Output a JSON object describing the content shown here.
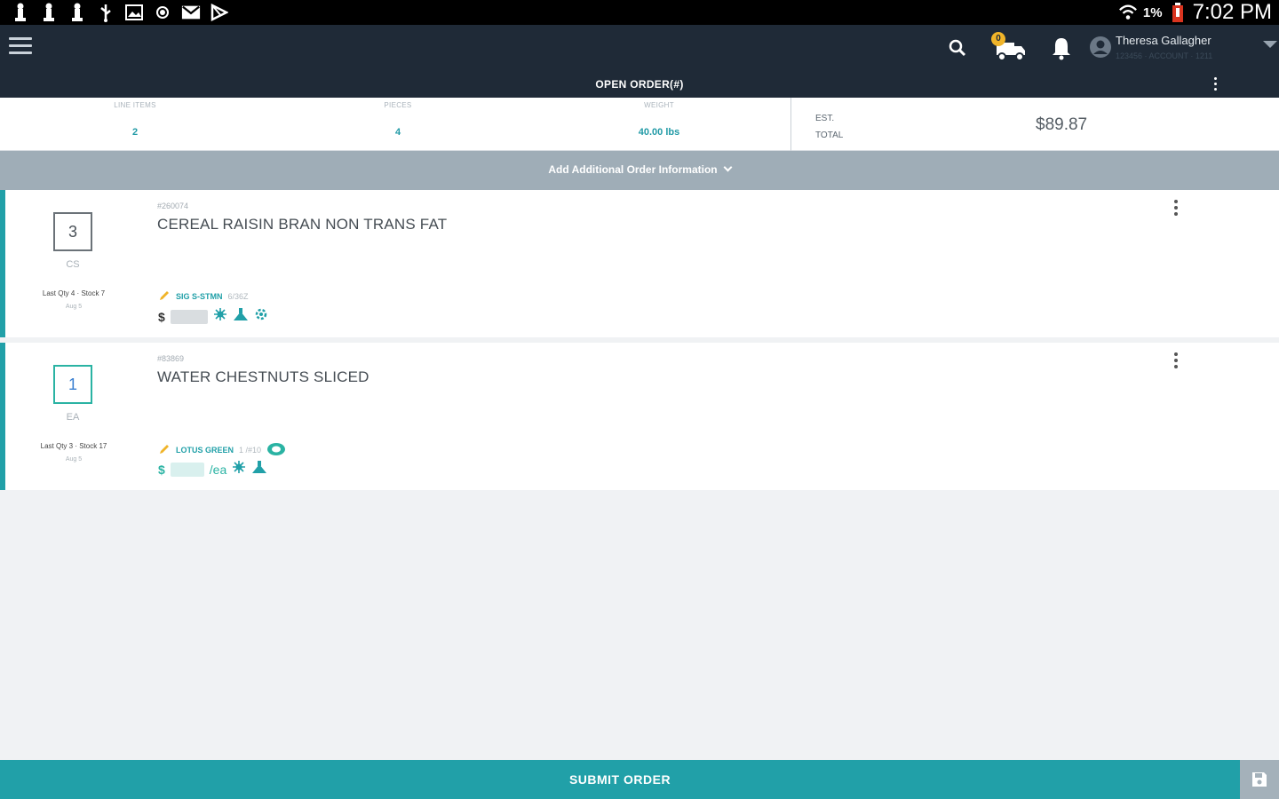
{
  "status_bar": {
    "battery_percent": "1%",
    "time": "7:02 PM"
  },
  "header": {
    "truck_badge": "0",
    "user_name": "Theresa Gallagher",
    "user_sub": "123456 · ACCOUNT · 1211"
  },
  "title_bar": {
    "title": "OPEN ORDER(#)"
  },
  "summary": {
    "line_items_label": "LINE ITEMS",
    "line_items_value": "2",
    "pieces_label": "PIECES",
    "pieces_value": "4",
    "weight_label": "WEIGHT",
    "weight_value": "40.00 lbs",
    "est_label_1": "EST.",
    "est_label_2": "TOTAL",
    "est_total": "$89.87"
  },
  "add_info": {
    "label": "Add Additional Order Information"
  },
  "items": [
    {
      "qty": "3",
      "uom": "CS",
      "last_qty": "Last Qty 4 · Stock 7",
      "last_date": "Aug 5",
      "item_number": "#260074",
      "name": "CEREAL RAISIN BRAN NON TRANS FAT",
      "brand": "SIG S-STMN",
      "pack": "6/36Z",
      "currency": "$",
      "per_unit": ""
    },
    {
      "qty": "1",
      "uom": "EA",
      "last_qty": "Last Qty 3 · Stock 17",
      "last_date": "Aug 5",
      "item_number": "#83869",
      "name": "WATER CHESTNUTS SLICED",
      "brand": "LOTUS GREEN",
      "pack": "1 /#10",
      "currency": "$",
      "per_unit": "/ea"
    }
  ],
  "footer": {
    "submit_label": "SUBMIT ORDER"
  },
  "colors": {
    "header_bg": "#1f2a37",
    "accent_teal": "#21a0a8",
    "addinfo_bg": "#9fadb7"
  }
}
